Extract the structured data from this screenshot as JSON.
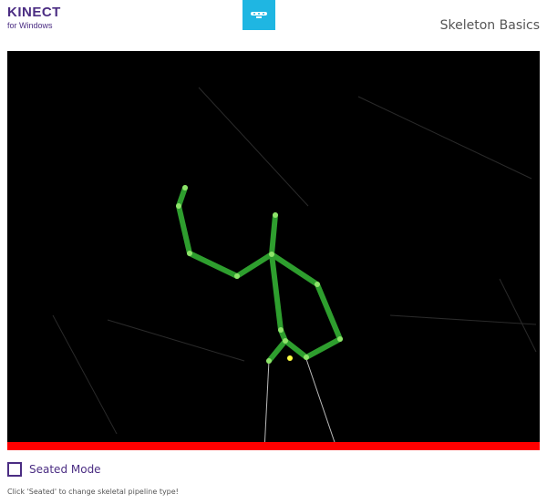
{
  "header": {
    "logo_title": "KINECT",
    "logo_subtitle": "for Windows",
    "sensor_icon": "kinect-sensor-icon",
    "app_title": "Skeleton Basics"
  },
  "viewport": {
    "background_color": "#000000",
    "bottom_clip_bar_color": "#ff0000",
    "bone_color": "#2e9e2e",
    "joint_color": "#8ee36a",
    "hip_center_joint_color": "#ffff44"
  },
  "controls": {
    "seated_checkbox_checked": false,
    "seated_label": "Seated Mode"
  },
  "status": {
    "text": "Click 'Seated' to change skeletal pipeline type!"
  }
}
